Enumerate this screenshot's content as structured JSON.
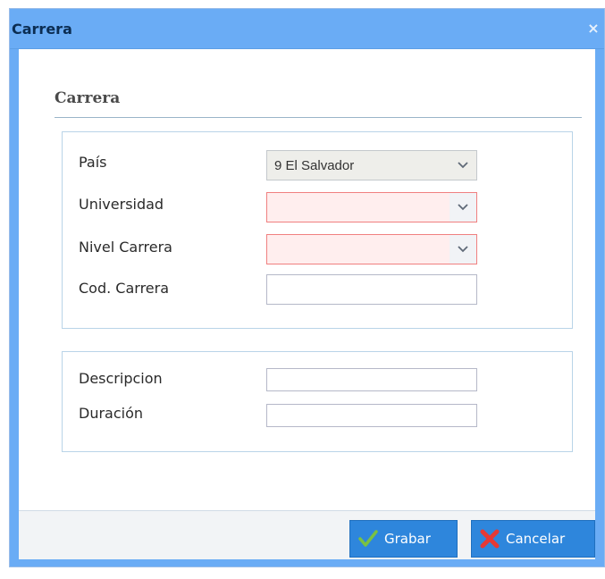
{
  "window": {
    "title": "Carrera",
    "close_glyph": "×"
  },
  "form": {
    "section_title": "Carrera",
    "fields": {
      "pais": {
        "label": "País",
        "value": "9 El Salvador"
      },
      "universidad": {
        "label": "Universidad",
        "value": ""
      },
      "nivel_carrera": {
        "label": "Nivel Carrera",
        "value": ""
      },
      "cod_carrera": {
        "label": "Cod. Carrera",
        "value": ""
      },
      "descripcion": {
        "label": "Descripcion",
        "value": ""
      },
      "duracion": {
        "label": "Duración",
        "value": ""
      }
    }
  },
  "footer": {
    "save_label": "Grabar",
    "cancel_label": "Cancelar"
  },
  "colors": {
    "title_bar": "#6aacf5",
    "button": "#2e86dc",
    "invalid_field": "#ffeeee",
    "save_icon": "#7ac142",
    "cancel_icon": "#e53935"
  }
}
